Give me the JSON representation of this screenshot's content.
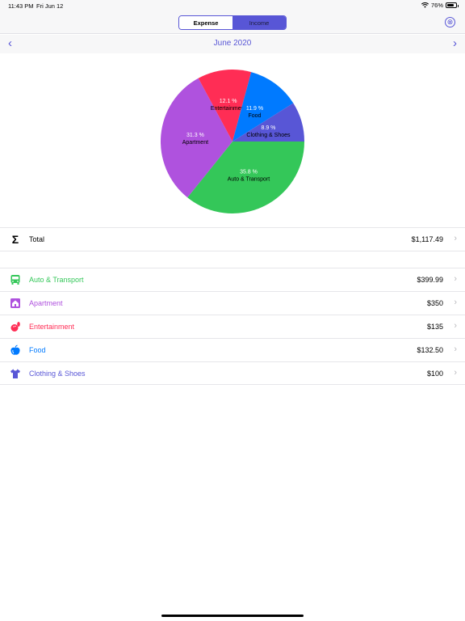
{
  "status_bar": {
    "time": "11:43 PM",
    "date": "Fri Jun 12",
    "battery": "76%",
    "battery_level": 0.76
  },
  "segment": {
    "expense": "Expense",
    "income": "Income",
    "selected": "expense"
  },
  "close_icon": "⊗",
  "month": {
    "title": "June 2020",
    "prev_icon": "‹",
    "next_icon": "›"
  },
  "chart_data": {
    "type": "pie",
    "slices": [
      {
        "label": "Auto & Transport",
        "percent_label": "35.8 %",
        "value": 399.99,
        "color": "#34c759"
      },
      {
        "label": "Apartment",
        "percent_label": "31.3 %",
        "value": 350,
        "color": "#af52de"
      },
      {
        "label": "Entertainment",
        "percent_label": "12.1 %",
        "value": 135,
        "color": "#ff2d55"
      },
      {
        "label": "Food",
        "percent_label": "11.9 %",
        "value": 132.5,
        "color": "#007aff"
      },
      {
        "label": "Clothing & Shoes",
        "percent_label": "8.9 %",
        "value": 100,
        "color": "#5856d6"
      }
    ]
  },
  "total": {
    "label": "Total",
    "icon": "Σ",
    "amount": "$1,117.49"
  },
  "categories": [
    {
      "name": "Auto & Transport",
      "amount": "$399.99",
      "color": "#34c759",
      "icon": "bus-icon"
    },
    {
      "name": "Apartment",
      "amount": "$350",
      "color": "#af52de",
      "icon": "house-icon"
    },
    {
      "name": "Entertainment",
      "amount": "$135",
      "color": "#ff2d55",
      "icon": "bowling-icon"
    },
    {
      "name": "Food",
      "amount": "$132.50",
      "color": "#007aff",
      "icon": "apple-icon"
    },
    {
      "name": "Clothing & Shoes",
      "amount": "$100",
      "color": "#5856d6",
      "icon": "shirt-icon"
    }
  ],
  "disclosure_icon": "›"
}
